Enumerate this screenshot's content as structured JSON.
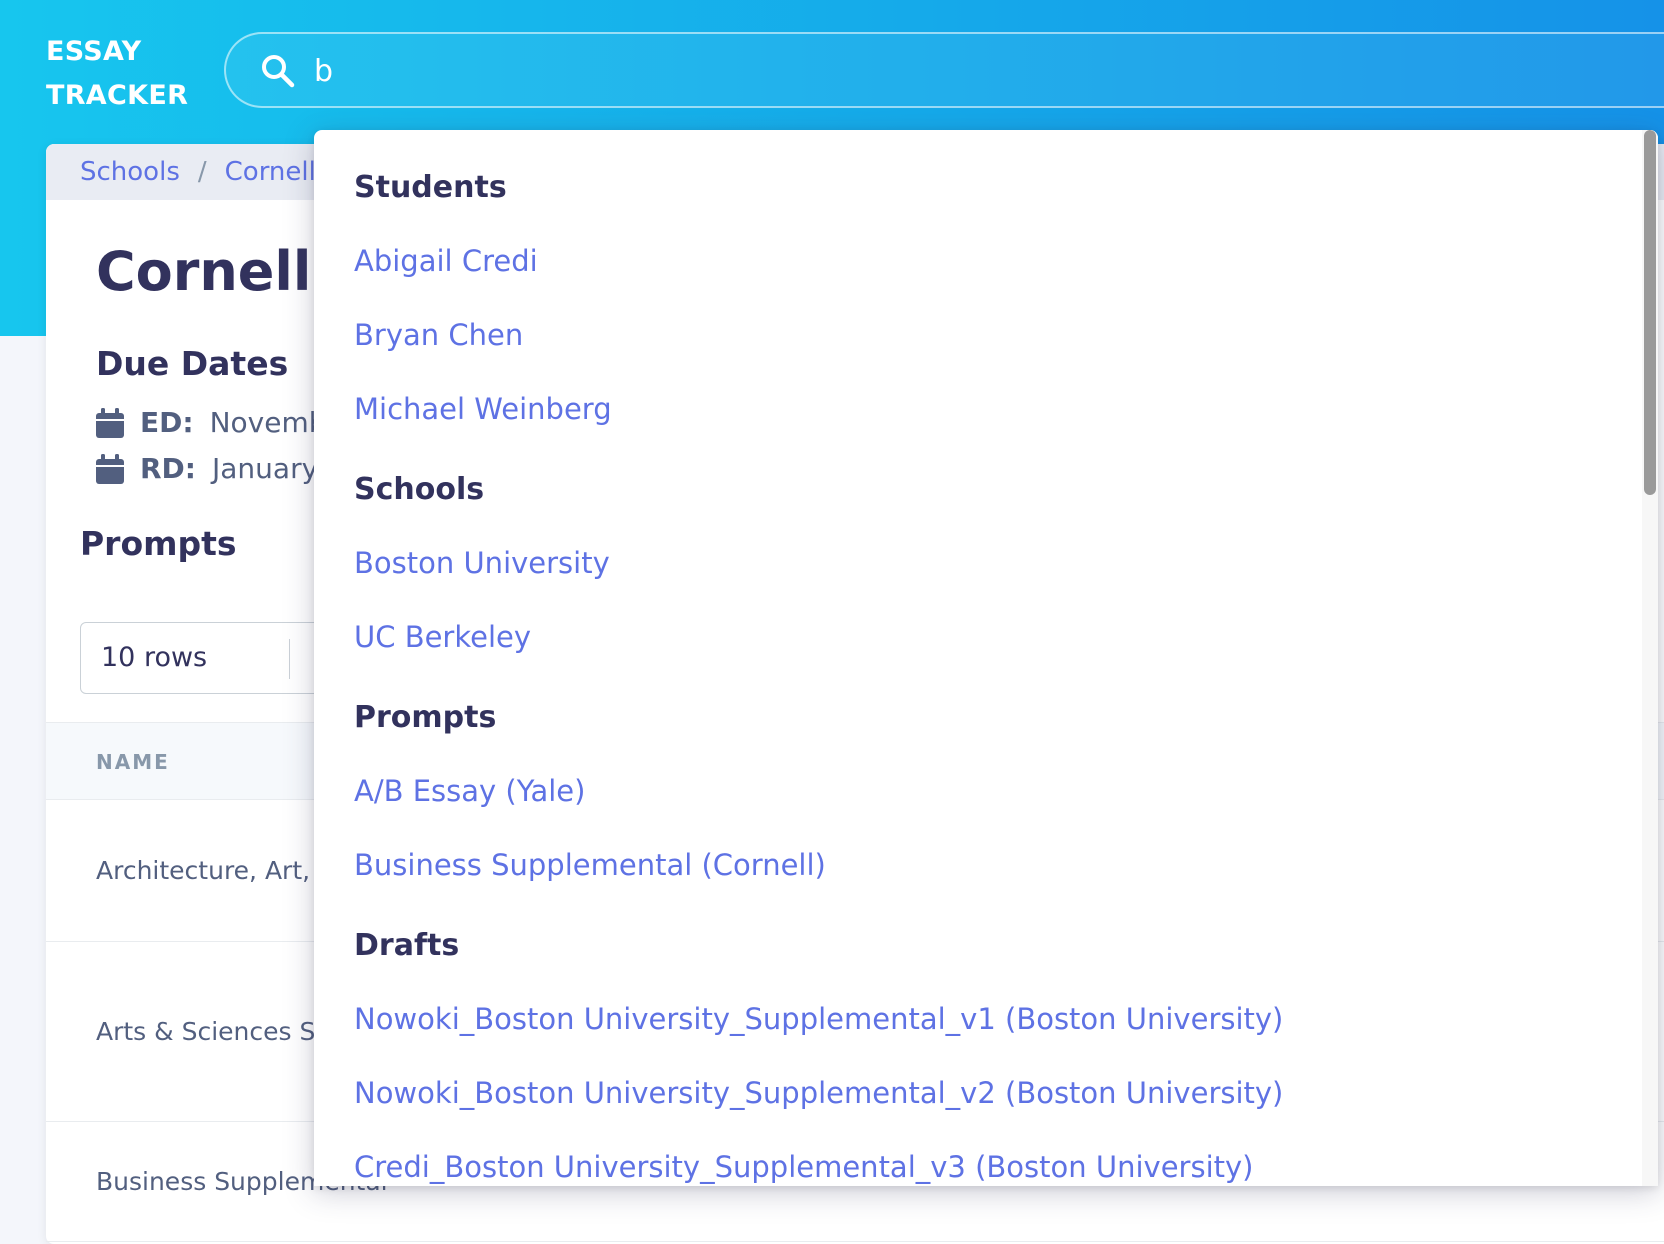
{
  "app": {
    "brand_line1": "ESSAY",
    "brand_line2": "TRACKER"
  },
  "search": {
    "value": "b",
    "placeholder": ""
  },
  "breadcrumb": {
    "items": [
      "Schools",
      "Cornell"
    ],
    "separator": "/"
  },
  "page": {
    "title": "Cornell",
    "due_dates_title": "Due Dates",
    "ed_label": "ED:",
    "ed_value": "Novemb",
    "rd_label": "RD:",
    "rd_value": "January",
    "prompts_title": "Prompts",
    "rows_select_value": "10 rows"
  },
  "table": {
    "header_name": "NAME",
    "rows": [
      "Architecture, Art, &",
      "Arts & Sciences Su",
      "Business Supplemental"
    ]
  },
  "dropdown": {
    "students_title": "Students",
    "students": [
      "Abigail Credi",
      "Bryan Chen",
      "Michael Weinberg"
    ],
    "schools_title": "Schools",
    "schools": [
      "Boston University",
      "UC Berkeley"
    ],
    "prompts_title": "Prompts",
    "prompts": [
      "A/B Essay (Yale)",
      "Business Supplemental (Cornell)"
    ],
    "drafts_title": "Drafts",
    "drafts": [
      "Nowoki_Boston University_Supplemental_v1 (Boston University)",
      "Nowoki_Boston University_Supplemental_v2 (Boston University)",
      "Credi_Boston University_Supplemental_v3 (Boston University)"
    ]
  },
  "colors": {
    "accent": "#5e72e4",
    "heading": "#32325d",
    "header_gradient_start": "#17c6ee",
    "header_gradient_end": "#1592e8"
  },
  "icons": {
    "search": "search-icon",
    "calendar": "calendar-icon"
  }
}
